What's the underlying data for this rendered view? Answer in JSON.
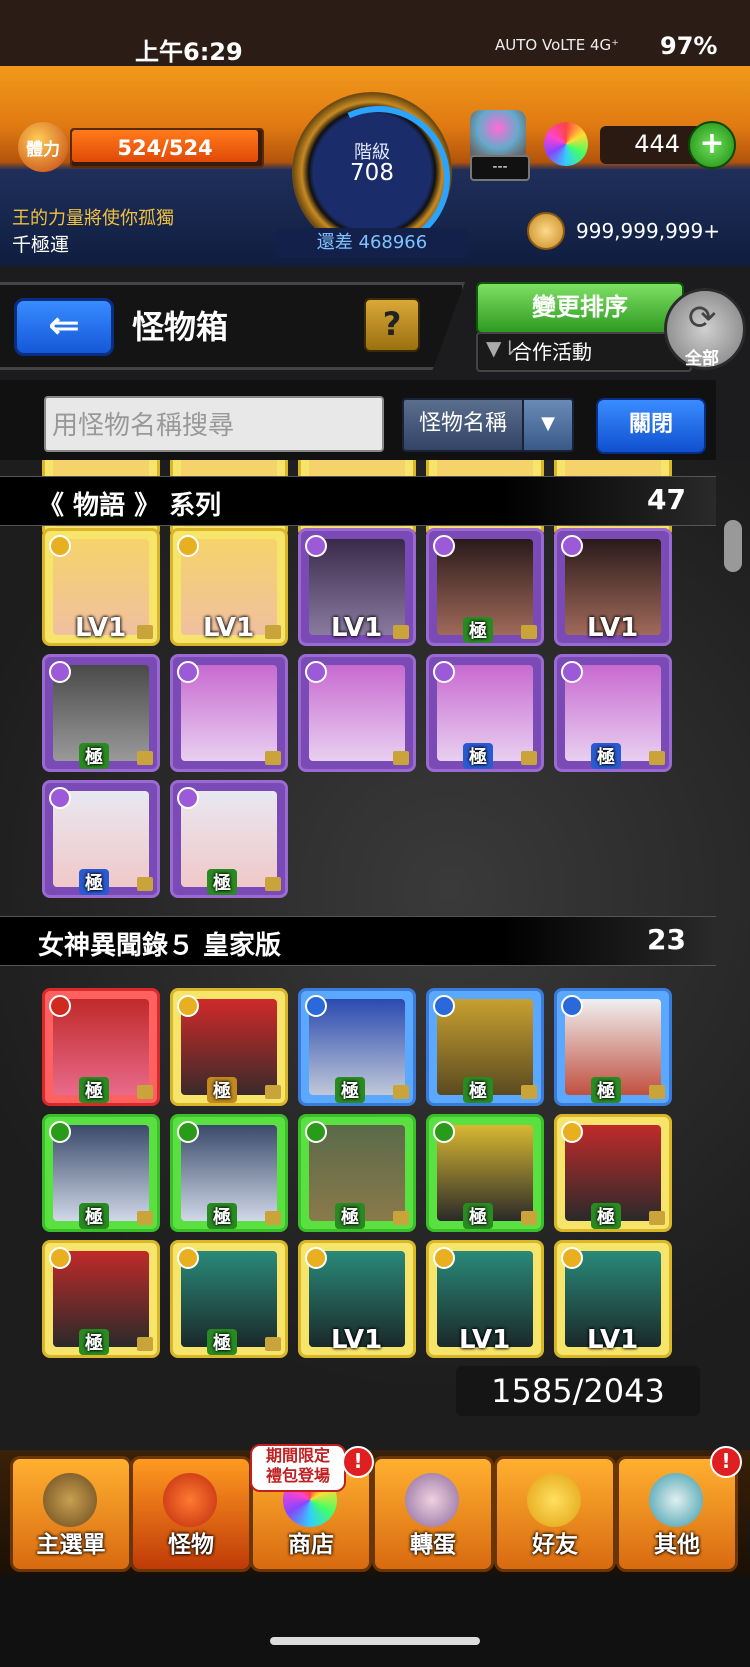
{
  "status_bar": {
    "time": "上午6:29",
    "icons": "AUTO  VoLTE  4G⁺",
    "battery": "97%"
  },
  "hud": {
    "stamina_label": "體力",
    "stamina_text": "524/524",
    "stamina_fraction": 1.0,
    "rank_label": "階級",
    "rank_value": "708",
    "rank_remaining": "還差 468966",
    "title_label": "王的力量將使你孤獨",
    "title_name": "千極運",
    "egg_counter": "---",
    "orb_count": "444",
    "orb_add_label": "+",
    "coin_count": "999,999,999+"
  },
  "header": {
    "back_label": "⇐",
    "page_title": "怪物箱",
    "help_label": "?",
    "sort_label": "變更排序",
    "filter_text": "合作活動",
    "all_label": "全部"
  },
  "search": {
    "placeholder": "用怪物名稱搜尋",
    "type_label": "怪物名稱",
    "close_label": "關閉"
  },
  "sections": [
    {
      "name": "《 物語 》 系列",
      "count": "47"
    },
    {
      "name": "女神異聞錄５ 皇家版",
      "count": "23"
    }
  ],
  "badges": {
    "lv": "LV1",
    "ji": "極"
  },
  "box_count": "1585/2043",
  "nav": {
    "home": "主選單",
    "monster": "怪物",
    "shop": "商店",
    "gacha": "轉蛋",
    "friends": "好友",
    "other": "其他",
    "shop_tag": "期間限定\n禮包登場",
    "alert": "!"
  },
  "colors": {
    "accent_orange": "#e07a12",
    "button_blue": "#1358d8",
    "button_green": "#2f9a22",
    "alert_red": "#e02020"
  }
}
